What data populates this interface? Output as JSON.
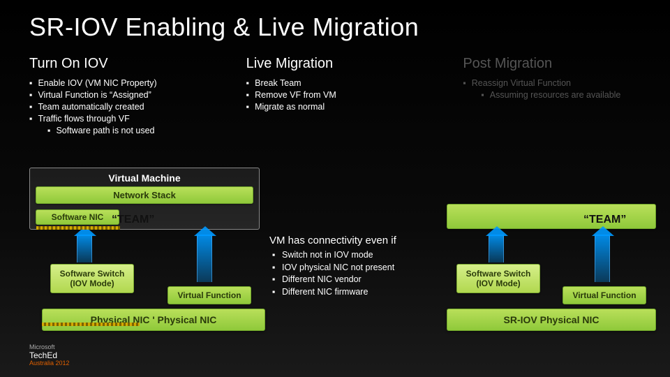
{
  "title": "SR-IOV Enabling & Live Migration",
  "columns": {
    "turn_on": {
      "heading": "Turn On IOV",
      "items": [
        "Enable IOV (VM NIC Property)",
        "Virtual Function is “Assigned”",
        "Team automatically created",
        "Traffic flows through VF"
      ],
      "sub_item": "Software path is not used"
    },
    "live": {
      "heading": "Live Migration",
      "items": [
        "Break Team",
        "Remove VF from VM",
        "Migrate as normal"
      ]
    },
    "post": {
      "heading": "Post Migration",
      "items": [
        "Reassign Virtual Function"
      ],
      "sub_item": "Assuming resources are available"
    }
  },
  "arch": {
    "vm_label": "Virtual Machine",
    "net_stack": "Network Stack",
    "soft_nic": "Software NIC",
    "soft_switch_l1": "Software Switch",
    "soft_switch_l2": "(IOV Mode)",
    "vf": "Virtual Function",
    "phys_left": "Physical NIC  '  Physical NIC",
    "phys_right": "SR-IOV Physical NIC",
    "team": "“TEAM”"
  },
  "mid": {
    "heading": "VM has connectivity even if",
    "items": [
      "Switch not in IOV mode",
      "IOV physical NIC not present",
      "Different NIC vendor",
      "Different NIC firmware"
    ]
  },
  "logo": {
    "brand_small": "Microsoft",
    "brand_big": "TechEd",
    "region": "Australia ",
    "year": "2012"
  }
}
